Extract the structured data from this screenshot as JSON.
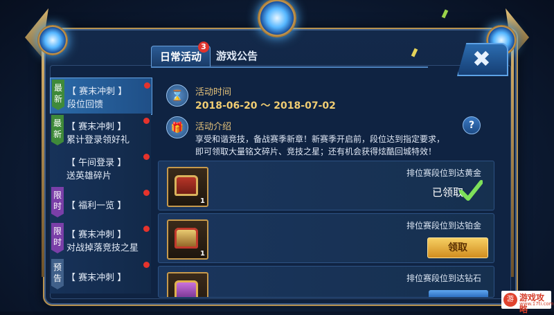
{
  "tabs": {
    "daily_label": "日常活动",
    "daily_badge": "3",
    "notice_label": "游戏公告",
    "close_glyph": "✖"
  },
  "sidebar": {
    "items": [
      {
        "tag": "最新",
        "tag_color": "green",
        "line1": "【 赛末冲刺 】",
        "line2": "段位回馈",
        "active": true,
        "dot": true
      },
      {
        "tag": "最新",
        "tag_color": "green",
        "line1": "【 赛末冲刺 】",
        "line2": "累计登录领好礼",
        "active": false,
        "dot": true
      },
      {
        "tag": "",
        "tag_color": "",
        "line1": "【 午间登录 】",
        "line2": "送英雄碎片",
        "active": false,
        "dot": true
      },
      {
        "tag": "限时",
        "tag_color": "purple",
        "line1": "【 福利一览 】",
        "line2": "",
        "active": false,
        "dot": true
      },
      {
        "tag": "限时",
        "tag_color": "purple",
        "line1": "【 赛末冲刺 】",
        "line2": "对战掉落竞技之星",
        "active": false,
        "dot": true
      },
      {
        "tag": "预告",
        "tag_color": "gray",
        "line1": "【 赛末冲刺 】",
        "line2": "",
        "active": false,
        "dot": true
      }
    ]
  },
  "info": {
    "time_label": "活动时间",
    "date_range": "2018-06-20 ～ 2018-07-02",
    "intro_label": "活动介绍",
    "intro_line1": "享受和谐竞技，备战赛季新章！新赛季开启前，段位达到指定要求，",
    "intro_line2": "即可领取大量铭文碎片、竞技之星；还有机会获得炫酷回城特效！",
    "help_glyph": "?"
  },
  "rewards": [
    {
      "title": "排位赛段位到达黄金",
      "count": "1",
      "status_text": "已领取",
      "chest": "red"
    },
    {
      "title": "排位赛段位到达铂金",
      "count": "1",
      "button_label": "领取",
      "chest": "gold"
    },
    {
      "title": "排位赛段位到达钻石",
      "count": "",
      "chest": "purple"
    }
  ],
  "colors": {
    "frame_gold": "#b8924e",
    "accent_blue": "#4e84c0",
    "claim_gold": "#f6cf63",
    "badge_red": "#e0332d"
  },
  "watermark": {
    "logo": "游",
    "text": "游戏攻略",
    "sub": "www.17ti.com"
  }
}
